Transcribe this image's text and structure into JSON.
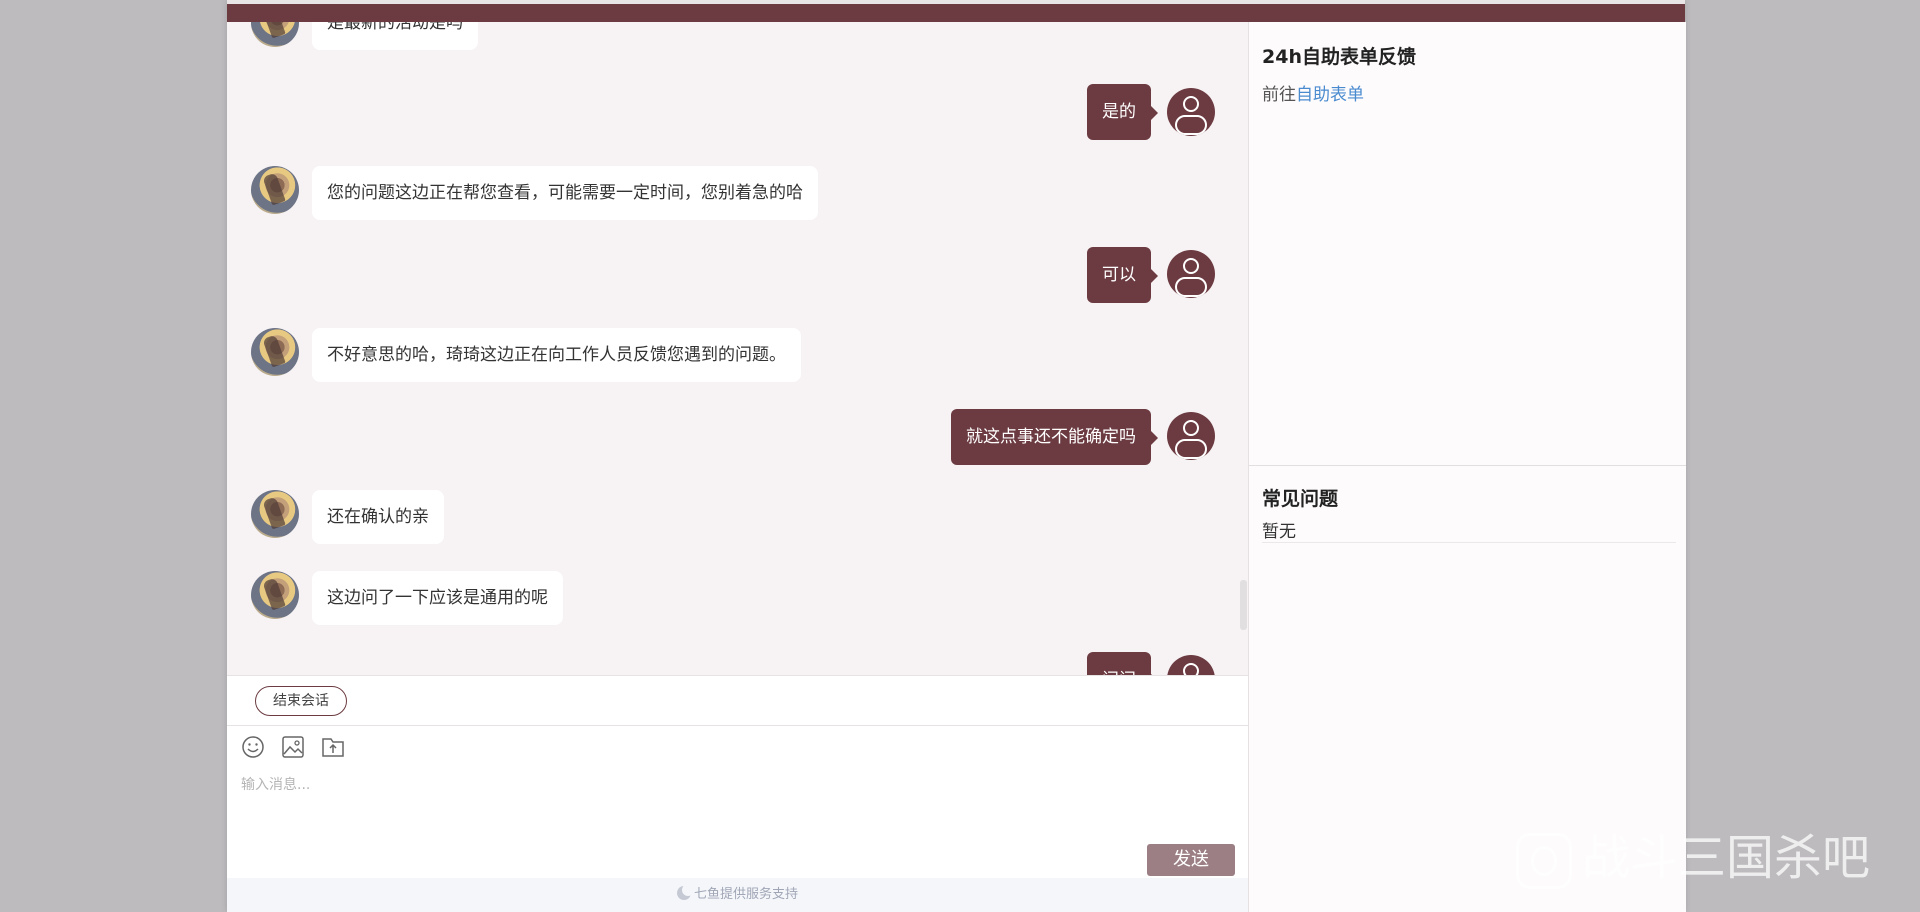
{
  "chat": {
    "messages": [
      {
        "from": "agent",
        "text": "是最新的活动是吗"
      },
      {
        "from": "user",
        "text": "是的"
      },
      {
        "from": "agent",
        "text": "您的问题这边正在帮您查看，可能需要一定时间，您别着急的哈"
      },
      {
        "from": "user",
        "text": "可以"
      },
      {
        "from": "agent",
        "text": "不好意思的哈，琦琦这边正在向工作人员反馈您遇到的问题。"
      },
      {
        "from": "user",
        "text": "就这点事还不能确定吗"
      },
      {
        "from": "agent",
        "text": "还在确认的亲"
      },
      {
        "from": "agent",
        "text": "这边问了一下应该是通用的呢"
      },
      {
        "from": "user",
        "text": "问问"
      }
    ]
  },
  "controls": {
    "end_session": "结束会话",
    "input_placeholder": "输入消息...",
    "send": "发送",
    "emoji_icon": "emoji-icon",
    "image_icon": "image-icon",
    "file_icon": "file-upload-icon"
  },
  "footer": {
    "text": "七鱼提供服务支持"
  },
  "sidebar": {
    "form_title": "24h自助表单反馈",
    "form_prefix": "前往",
    "form_link": "自助表单",
    "faq_title": "常见问题",
    "faq_empty": "暂无"
  },
  "watermark": {
    "text": "战斗三国杀吧"
  },
  "colors": {
    "accent": "#6c3b41",
    "send_button": "#9b7f84",
    "link": "#4a8bcf"
  }
}
